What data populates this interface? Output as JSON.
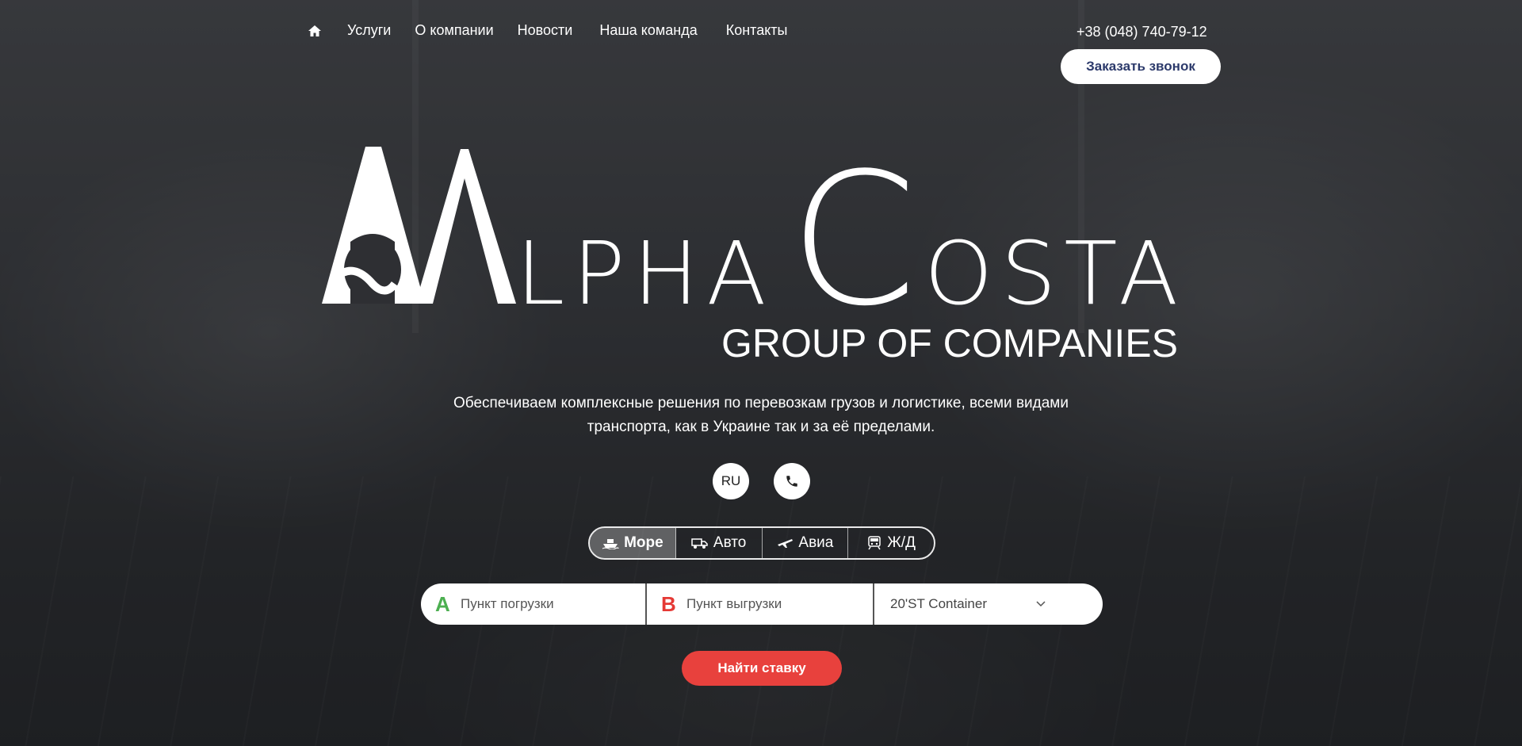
{
  "nav": {
    "items": [
      {
        "label": "Услуги"
      },
      {
        "label": "О компании"
      },
      {
        "label": "Новости"
      },
      {
        "label": "Наша команда"
      },
      {
        "label": "Контакты"
      }
    ]
  },
  "header": {
    "phone": "+38 (048) 740-79-12",
    "callback_label": "Заказать звонок"
  },
  "logo": {
    "text_alpha": "LPHA",
    "text_costa": "OSTA",
    "subtitle": "GROUP OF COMPANIES"
  },
  "hero": {
    "tagline_line1": "Обеспечиваем комплексные решения по перевозкам грузов и логистике, всеми видами",
    "tagline_line2": "транспорта, как в Украине так и за её пределами.",
    "lang_label": "RU"
  },
  "tabs": [
    {
      "label": "Море",
      "icon": "ship-icon",
      "active": true
    },
    {
      "label": "Авто",
      "icon": "truck-icon",
      "active": false
    },
    {
      "label": "Авиа",
      "icon": "plane-icon",
      "active": false
    },
    {
      "label": "Ж/Д",
      "icon": "train-icon",
      "active": false
    }
  ],
  "search": {
    "from_letter": "A",
    "from_placeholder": "Пункт погрузки",
    "to_letter": "B",
    "to_placeholder": "Пункт выгрузки",
    "container_value": "20'ST Container"
  },
  "find_label": "Найти ставку",
  "colors": {
    "accent_red": "#e8413d",
    "letter_a": "#4caf50",
    "letter_b": "#e53935",
    "callback_text": "#2c3a6b"
  }
}
